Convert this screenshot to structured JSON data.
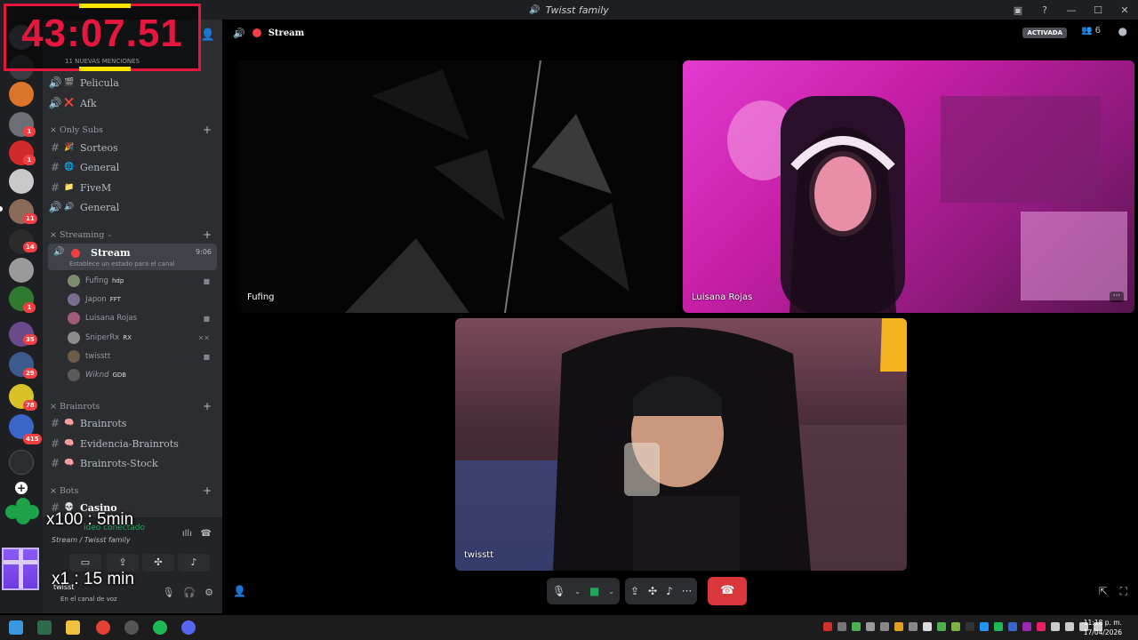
{
  "window": {
    "title": "Twisst family"
  },
  "sidebar": {
    "voice_channels_top": [
      {
        "name": "Pelicula",
        "emoji": "🎬"
      },
      {
        "name": "Afk",
        "emoji": "❌"
      }
    ],
    "categories": [
      {
        "name": "Only Subs",
        "channels": [
          {
            "name": "Sorteos",
            "emoji": "🎉"
          },
          {
            "name": "General",
            "emoji": "🌐"
          },
          {
            "name": "FiveM",
            "emoji": "📁"
          },
          {
            "name": "General",
            "emoji": "🔊"
          }
        ]
      },
      {
        "name": "Streaming"
      },
      {
        "name": "Brainrots",
        "channels": [
          {
            "name": "Brainrots",
            "emoji": "🧠"
          },
          {
            "name": "Evidencia-Brainrots",
            "emoji": "🧠"
          },
          {
            "name": "Brainrots-Stock",
            "emoji": "🧠"
          }
        ]
      },
      {
        "name": "Bots",
        "channels": [
          {
            "name": "Casino",
            "emoji": "💀"
          }
        ]
      }
    ],
    "active_channel": {
      "name": "Stream",
      "time": "9:06",
      "status": "Establece un estado para el canal"
    },
    "members": [
      {
        "name": "Fufing",
        "tag": "hdp",
        "color": "#7e8a6e"
      },
      {
        "name": "Japon",
        "tag": "FFT",
        "color": "#7a6c8c"
      },
      {
        "name": "Luisana Rojas",
        "tag": "",
        "color": "#a05a7a"
      },
      {
        "name": "SniperRx",
        "tag": "RX",
        "color": "#8c8c8c"
      },
      {
        "name": "twisstt",
        "tag": "",
        "color": "#6c5a4a"
      },
      {
        "name": "Wiknd",
        "tag": "GDB",
        "color": "#5a5a5a"
      }
    ],
    "voice_panel": {
      "connected": "ideo conectado",
      "location": "Stream / Twisst family"
    },
    "user_panel": {
      "name": "twisst",
      "status": "En el canal de voz"
    }
  },
  "overlays": {
    "timer": "43:07.51",
    "timer_sub": "11 NUEVAS MENCIONES",
    "multiplier_1": "x100 : 5min",
    "multiplier_2": "x1 : 15 min"
  },
  "main": {
    "title": "Stream",
    "activada": "ACTIVADA",
    "people_count": "6",
    "tiles": [
      {
        "label": "Fufing"
      },
      {
        "label": "Luisana Rojas"
      },
      {
        "label": "twisstt"
      }
    ]
  },
  "rail_badges": [
    "1",
    "1",
    "11",
    "14",
    "1",
    "35",
    "29",
    "78",
    "415"
  ],
  "taskbar": {
    "time": "11:18 p. m.",
    "date": "17/04/2026"
  },
  "colors": {
    "accent": "#5865f2",
    "danger": "#da373c",
    "online": "#23a55a",
    "timer": "#e5173f"
  }
}
